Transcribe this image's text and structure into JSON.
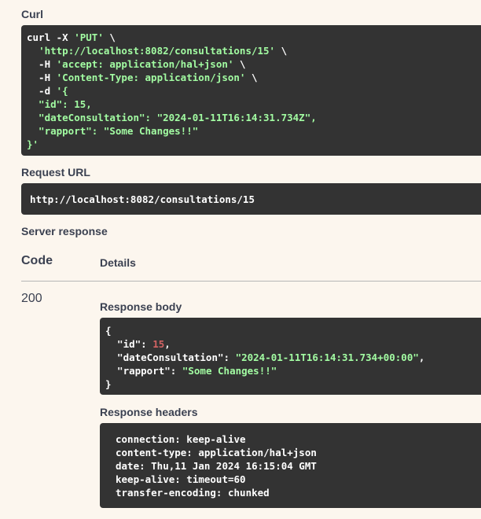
{
  "sections": {
    "curl_title": "Curl",
    "request_url_title": "Request URL",
    "server_response_title": "Server response"
  },
  "curl": {
    "line1_cmd": "curl -X ",
    "line1_method": "'PUT'",
    "line1_tail": " \\",
    "line2_url": "'http://localhost:8082/consultations/15'",
    "line2_tail": " \\",
    "line3_flag": "  -H ",
    "line3_value": "'accept: application/hal+json'",
    "line3_tail": " \\",
    "line4_flag": "  -H ",
    "line4_value": "'Content-Type: application/json'",
    "line4_tail": " \\",
    "line5_flag": "  -d ",
    "line5_value": "'{",
    "line6": "  \"id\": 15,",
    "line7": "  \"dateConsultation\": \"2024-01-11T16:14:31.734Z\",",
    "line8": "  \"rapport\": \"Some Changes!!\"",
    "line9": "}'"
  },
  "request_url": "http://localhost:8082/consultations/15",
  "response_table": {
    "code_header": "Code",
    "details_header": "Details",
    "status_code": "200",
    "response_body_title": "Response body",
    "response_headers_title": "Response headers"
  },
  "response_body": {
    "open_brace": "{",
    "id_key": "  \"id\"",
    "id_sep": ": ",
    "id_value": "15",
    "id_comma": ",",
    "date_key": "  \"dateConsultation\"",
    "date_sep": ": ",
    "date_value": "\"2024-01-11T16:14:31.734+00:00\"",
    "date_comma": ",",
    "rapport_key": "  \"rapport\"",
    "rapport_sep": ": ",
    "rapport_value": "\"Some Changes!!\"",
    "close_brace": "}"
  },
  "response_headers": [
    "connection: keep-alive",
    "content-type: application/hal+json",
    "date: Thu,11 Jan 2024 16:15:04 GMT",
    "keep-alive: timeout=60",
    "transfer-encoding: chunked"
  ]
}
